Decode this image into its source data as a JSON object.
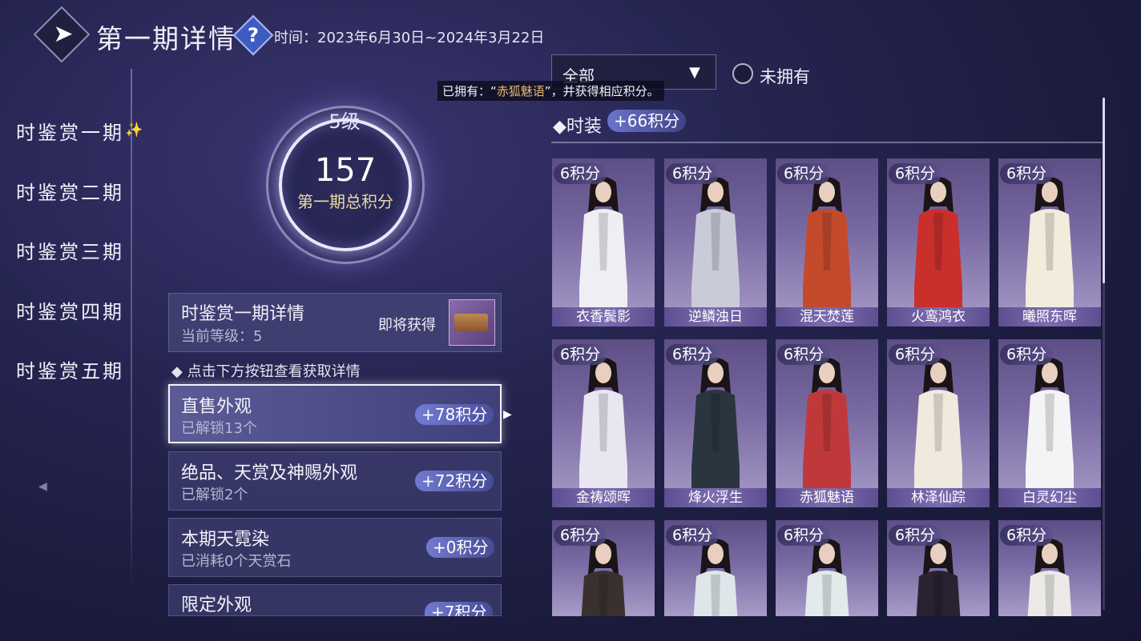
{
  "header": {
    "title": "第一期详情",
    "period": "时间：2023年6月30日~2024年3月22日"
  },
  "sidebar": {
    "items": [
      "时鉴赏一期",
      "时鉴赏二期",
      "时鉴赏三期",
      "时鉴赏四期",
      "时鉴赏五期"
    ],
    "active_index": 0
  },
  "summary": {
    "level": "5级",
    "score": "157",
    "score_label": "第一期总积分"
  },
  "detail": {
    "title": "时鉴赏一期详情",
    "current_level": "当前等级：5",
    "coming_label": "即将获得"
  },
  "hint": "点击下方按钮查看获取详情",
  "categories": [
    {
      "title": "直售外观",
      "sub": "已解锁13个",
      "points": "+78积分",
      "selected": true
    },
    {
      "title": "绝品、天赏及神赐外观",
      "sub": "已解锁2个",
      "points": "+72积分",
      "selected": false
    },
    {
      "title": "本期天霓染",
      "sub": "已消耗0个天赏石",
      "points": "+0积分",
      "selected": false
    },
    {
      "title": "限定外观",
      "sub": "",
      "points": "+7积分",
      "selected": false
    }
  ],
  "filter": {
    "dropdown_value": "全部",
    "radio_label": "未拥有",
    "radio_checked": false
  },
  "tooltip": {
    "prefix": "已拥有：“",
    "highlight": "赤狐魅语",
    "suffix": "”，并获得相应积分。"
  },
  "section": {
    "title": "时装",
    "points": "+66积分"
  },
  "outfits": [
    {
      "name": "衣香鬓影",
      "points": "6积分",
      "color": "#eeeef4"
    },
    {
      "name": "逆鳞浊日",
      "points": "6积分",
      "color": "#c9ccd8"
    },
    {
      "name": "混天焚莲",
      "points": "6积分",
      "color": "#c44a2c"
    },
    {
      "name": "火鸾鸿衣",
      "points": "6积分",
      "color": "#c9302c"
    },
    {
      "name": "曦照东晖",
      "points": "6积分",
      "color": "#f1ecdc"
    },
    {
      "name": "金祷颂晖",
      "points": "6积分",
      "color": "#e8e6f0"
    },
    {
      "name": "烽火浮生",
      "points": "6积分",
      "color": "#2b3540"
    },
    {
      "name": "赤狐魅语",
      "points": "6积分",
      "color": "#c0393a"
    },
    {
      "name": "林泽仙踪",
      "points": "6积分",
      "color": "#efe9e0"
    },
    {
      "name": "白灵幻尘",
      "points": "6积分",
      "color": "#f4f4f6"
    },
    {
      "name": "",
      "points": "6积分",
      "color": "#3a3030"
    },
    {
      "name": "",
      "points": "6积分",
      "color": "#dfe6ea"
    },
    {
      "name": "",
      "points": "6积分",
      "color": "#e2eaec"
    },
    {
      "name": "",
      "points": "6积分",
      "color": "#2a2230"
    },
    {
      "name": "",
      "points": "6积分",
      "color": "#eceae6"
    }
  ]
}
